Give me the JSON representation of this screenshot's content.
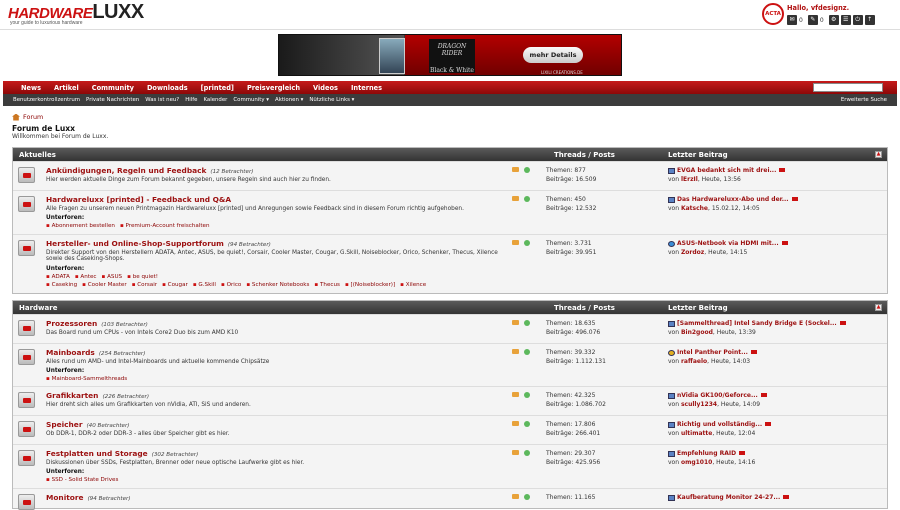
{
  "logo": {
    "hardware": "HARDWARE",
    "luxx": "LUXX",
    "tagline": "your guide to luxurious hardware"
  },
  "user": {
    "greeting": "Hallo, vfdesignz.",
    "seal": "ACTA",
    "counts": [
      "0",
      "0"
    ]
  },
  "banner": {
    "product": "DRAGON RIDER",
    "edition": "Black & White",
    "button": "mehr Details",
    "small": "LIXILI CREATIONS.DE"
  },
  "nav": {
    "items": [
      "News",
      "Artikel",
      "Community",
      "Downloads",
      "[printed]",
      "Preisvergleich",
      "Videos",
      "Internes"
    ]
  },
  "subnav": {
    "items": [
      "Benutzerkontrollzentrum",
      "Private Nachrichten",
      "Was ist neu?",
      "Hilfe",
      "Kalender",
      "Community ▾",
      "Aktionen ▾",
      "Nützliche Links ▾"
    ],
    "advanced_search": "Erweiterte Suche"
  },
  "breadcrumb": "Forum",
  "page": {
    "title": "Forum de Luxx",
    "welcome": "Willkommen bei Forum de Luxx."
  },
  "columns": {
    "threads_posts": "Threads / Posts",
    "last_post": "Letzter Beitrag"
  },
  "sections": [
    {
      "title": "Aktuelles",
      "forums": [
        {
          "name": "Ankündigungen, Regeln und Feedback",
          "viewers": "(12 Betrachter)",
          "desc": "Hier werden aktuelle Dinge zum Forum bekannt gegeben, unsere Regeln sind auch hier zu finden.",
          "themen": "Themen: 877",
          "beitraege": "Beiträge: 16.509",
          "last_title": "EVGA bedankt sich mit drei...",
          "last_by": "von",
          "last_user": "lErzIl",
          "last_date": ", Heute, 13:56",
          "icon": "post"
        },
        {
          "name": "Hardwareluxx [printed] - Feedback und Q&A",
          "viewers": "",
          "desc": "Alle Fragen zu unserem neuen Printmagazin Hardwareluxx [printed] und Anregungen sowie Feedback sind in diesem Forum richtig aufgehoben.",
          "sub_label": "Unterforen:",
          "subforums": [
            "Abonnement bestellen",
            "Premium-Account freischalten"
          ],
          "themen": "Themen: 450",
          "beitraege": "Beiträge: 12.532",
          "last_title": "Das Hardwareluxx-Abo und der...",
          "last_by": "von",
          "last_user": "Katsche",
          "last_date": ", 15.02.12, 14:05",
          "icon": "post"
        },
        {
          "name": "Hersteller- und Online-Shop-Supportforum",
          "viewers": "(94 Betrachter)",
          "desc": "Direkter Support von den Herstellern ADATA, Antec, ASUS, be quiet!, Corsair, Cooler Master, Cougar, G.Skill, Noiseblocker, Orico, Schenker, Thecus, Xilence",
          "desc2": "sowie des Caseking-Shops.",
          "sub_label": "Unterforen:",
          "subforums": [
            "ADATA",
            "Antec",
            "ASUS",
            "be quiet!",
            "Caseking",
            "Cooler Master",
            "Corsair",
            "Cougar",
            "G.Skill",
            "Orico",
            "Schenker Notebooks",
            "Thecus",
            "[(Noiseblocker)]",
            "Xilence"
          ],
          "themen": "Themen: 3.731",
          "beitraege": "Beiträge: 39.951",
          "last_title": "ASUS-Netbook via HDMI mit...",
          "last_by": "von",
          "last_user": "Zordoz",
          "last_date": ", Heute, 14:15",
          "icon": "question"
        }
      ]
    },
    {
      "title": "Hardware",
      "forums": [
        {
          "name": "Prozessoren",
          "viewers": "(103 Betrachter)",
          "desc": "Das Board rund um CPUs - von Intels Core2 Duo bis zum AMD K10",
          "themen": "Themen: 18.635",
          "beitraege": "Beiträge: 496.076",
          "last_title": "[Sammelthread] Intel Sandy Bridge E (Sockel...",
          "last_by": "von",
          "last_user": "Bin2good",
          "last_date": ", Heute, 13:39",
          "icon": "post"
        },
        {
          "name": "Mainboards",
          "viewers": "(254 Betrachter)",
          "desc": "Alles rund um AMD- und Intel-Mainboards und aktuelle kommende Chipsätze",
          "sub_label": "Unterforen:",
          "subforums": [
            "Mainboard-Sammelthreads"
          ],
          "themen": "Themen: 39.332",
          "beitraege": "Beiträge: 1.112.131",
          "last_title": "Intel Panther Point...",
          "last_by": "von",
          "last_user": "raffaelo",
          "last_date": ", Heute, 14:03",
          "icon": "smile"
        },
        {
          "name": "Grafikkarten",
          "viewers": "(226 Betrachter)",
          "desc": "Hier dreht sich alles um Grafikkarten von nVidia, ATI, SiS und anderen.",
          "themen": "Themen: 42.325",
          "beitraege": "Beiträge: 1.086.702",
          "last_title": "nVidia GK100/Geforce...",
          "last_by": "von",
          "last_user": "scully1234",
          "last_date": ", Heute, 14:09",
          "icon": "post"
        },
        {
          "name": "Speicher",
          "viewers": "(40 Betrachter)",
          "desc": "Ob DDR-1, DDR-2 oder DDR-3 - alles über Speicher gibt es hier.",
          "themen": "Themen: 17.806",
          "beitraege": "Beiträge: 266.401",
          "last_title": "Richtig und vollständig...",
          "last_by": "von",
          "last_user": "ultimatte",
          "last_date": ", Heute, 12:04",
          "icon": "post"
        },
        {
          "name": "Festplatten und Storage",
          "viewers": "(302 Betrachter)",
          "desc": "Diskussionen über SSDs, Festplatten, Brenner oder neue optische Laufwerke gibt es hier.",
          "sub_label": "Unterforen:",
          "subforums": [
            "SSD - Solid State Drives"
          ],
          "themen": "Themen: 29.307",
          "beitraege": "Beiträge: 425.956",
          "last_title": "Empfehlung RAID",
          "last_by": "von",
          "last_user": "omg1010",
          "last_date": ", Heute, 14:16",
          "icon": "post"
        },
        {
          "name": "Monitore",
          "viewers": "(94 Betrachter)",
          "desc": "",
          "themen": "Themen: 11.165",
          "beitraege": "",
          "last_title": "Kaufberatung Monitor 24-27...",
          "last_by": "",
          "last_user": "",
          "last_date": "",
          "icon": "post"
        }
      ]
    }
  ]
}
